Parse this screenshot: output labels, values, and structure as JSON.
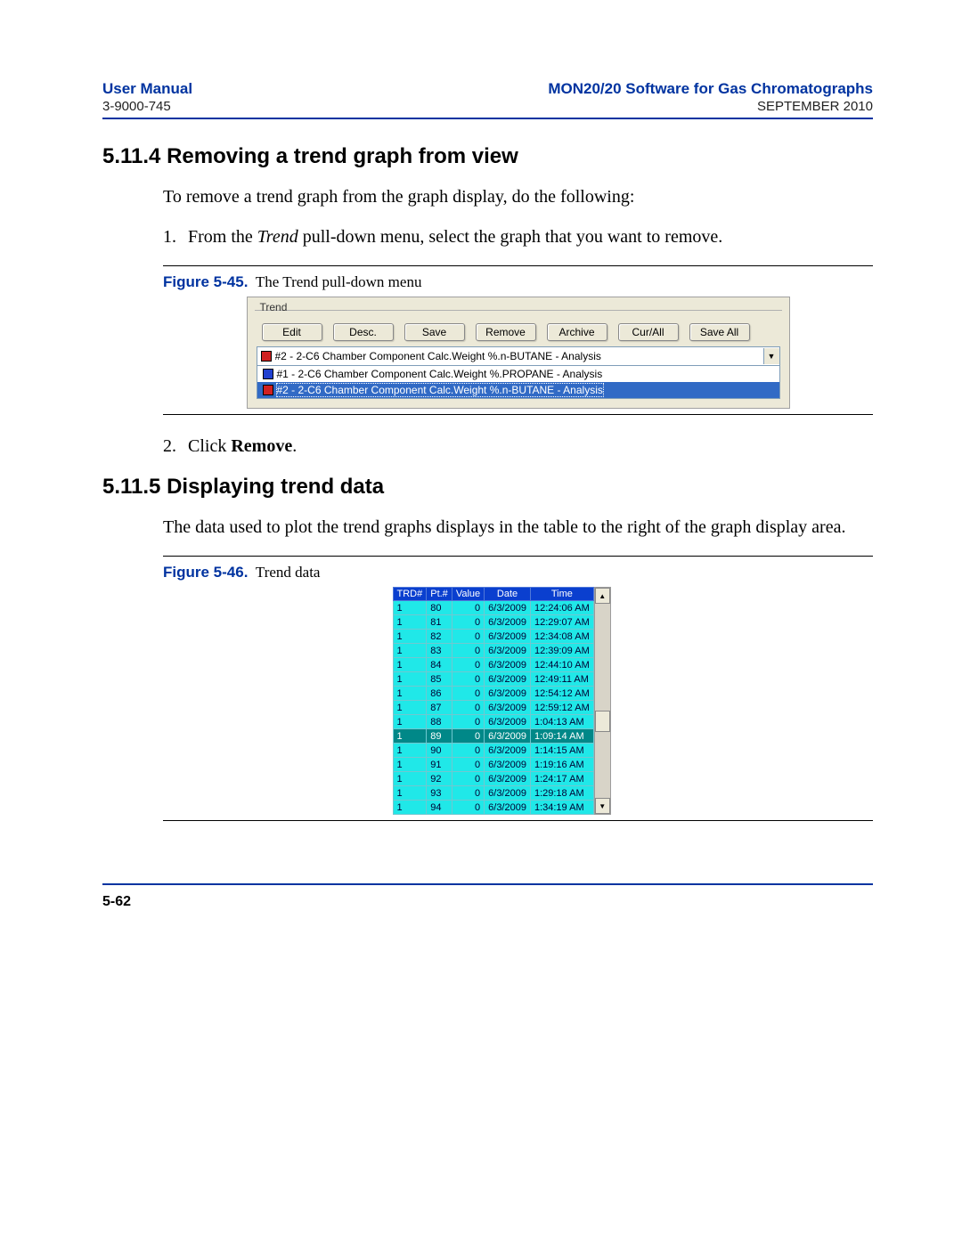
{
  "header": {
    "manual_title": "User Manual",
    "doc_num": "3-9000-745",
    "software_title": "MON20/20 Software for Gas Chromatographs",
    "date": "SEPTEMBER 2010"
  },
  "section1": {
    "number": "5.11.4",
    "title": "Removing a trend graph from view",
    "intro": "To remove a trend graph from the graph display, do the following:",
    "step1_prefix": "From the ",
    "step1_italic": "Trend",
    "step1_suffix": " pull-down menu, select the graph that you want to remove.",
    "step2_prefix": "Click ",
    "step2_bold": "Remove",
    "step2_suffix": "."
  },
  "fig45": {
    "num": "Figure 5-45.",
    "caption": "The Trend pull-down menu",
    "group_label": "Trend",
    "buttons": [
      "Edit",
      "Desc.",
      "Save",
      "Remove",
      "Archive",
      "Cur/All",
      "Save All"
    ],
    "selected": {
      "color": "#d02020",
      "text": "#2 - 2-C6 Chamber Component Calc.Weight %.n-BUTANE - Analysis"
    },
    "options": [
      {
        "color": "#2040d0",
        "text": "#1 - 2-C6 Chamber Component Calc.Weight %.PROPANE - Analysis",
        "selected": false
      },
      {
        "color": "#d02020",
        "text": "#2 - 2-C6 Chamber Component Calc.Weight %.n-BUTANE - Analysis",
        "selected": true
      }
    ]
  },
  "section2": {
    "number": "5.11.5",
    "title": "Displaying trend data",
    "intro": "The data used to plot the trend graphs displays in the table to the right of the graph display area."
  },
  "fig46": {
    "num": "Figure 5-46.",
    "caption": "Trend data",
    "headers": [
      "TRD#",
      "Pt.#",
      "Value",
      "Date",
      "Time"
    ],
    "rows": [
      {
        "trd": "1",
        "pt": "80",
        "val": "0",
        "date": "6/3/2009",
        "time": "12:24:06 AM",
        "sel": false
      },
      {
        "trd": "1",
        "pt": "81",
        "val": "0",
        "date": "6/3/2009",
        "time": "12:29:07 AM",
        "sel": false
      },
      {
        "trd": "1",
        "pt": "82",
        "val": "0",
        "date": "6/3/2009",
        "time": "12:34:08 AM",
        "sel": false
      },
      {
        "trd": "1",
        "pt": "83",
        "val": "0",
        "date": "6/3/2009",
        "time": "12:39:09 AM",
        "sel": false
      },
      {
        "trd": "1",
        "pt": "84",
        "val": "0",
        "date": "6/3/2009",
        "time": "12:44:10 AM",
        "sel": false
      },
      {
        "trd": "1",
        "pt": "85",
        "val": "0",
        "date": "6/3/2009",
        "time": "12:49:11 AM",
        "sel": false
      },
      {
        "trd": "1",
        "pt": "86",
        "val": "0",
        "date": "6/3/2009",
        "time": "12:54:12 AM",
        "sel": false
      },
      {
        "trd": "1",
        "pt": "87",
        "val": "0",
        "date": "6/3/2009",
        "time": "12:59:12 AM",
        "sel": false
      },
      {
        "trd": "1",
        "pt": "88",
        "val": "0",
        "date": "6/3/2009",
        "time": "1:04:13 AM",
        "sel": false
      },
      {
        "trd": "1",
        "pt": "89",
        "val": "0",
        "date": "6/3/2009",
        "time": "1:09:14 AM",
        "sel": true
      },
      {
        "trd": "1",
        "pt": "90",
        "val": "0",
        "date": "6/3/2009",
        "time": "1:14:15 AM",
        "sel": false
      },
      {
        "trd": "1",
        "pt": "91",
        "val": "0",
        "date": "6/3/2009",
        "time": "1:19:16 AM",
        "sel": false
      },
      {
        "trd": "1",
        "pt": "92",
        "val": "0",
        "date": "6/3/2009",
        "time": "1:24:17 AM",
        "sel": false
      },
      {
        "trd": "1",
        "pt": "93",
        "val": "0",
        "date": "6/3/2009",
        "time": "1:29:18 AM",
        "sel": false
      },
      {
        "trd": "1",
        "pt": "94",
        "val": "0",
        "date": "6/3/2009",
        "time": "1:34:19 AM",
        "sel": false
      }
    ]
  },
  "footer": {
    "page_num": "5-62"
  }
}
